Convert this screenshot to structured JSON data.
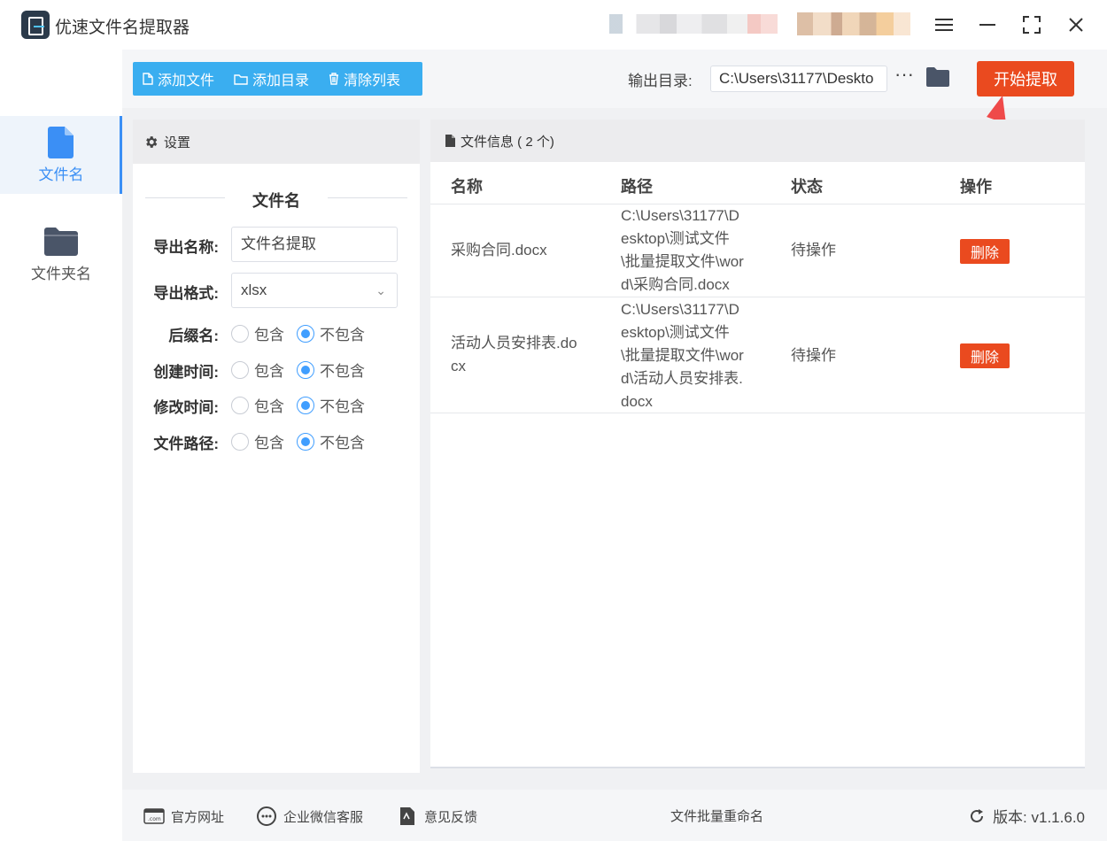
{
  "app": {
    "title": "优速文件名提取器"
  },
  "nav": [
    {
      "label": "文件名",
      "icon": "file-icon",
      "active": true
    },
    {
      "label": "文件夹名",
      "icon": "folder-icon",
      "active": false
    }
  ],
  "toolbar": {
    "add_file": "添加文件",
    "add_dir": "添加目录",
    "clear_list": "清除列表",
    "output_label": "输出目录:",
    "output_value": "C:\\Users\\31177\\Deskto",
    "more": "···",
    "start": "开始提取"
  },
  "settings": {
    "header": "设置",
    "section_title": "文件名",
    "export_name_label": "导出名称:",
    "export_name_value": "文件名提取",
    "export_format_label": "导出格式:",
    "export_format_value": "xlsx",
    "options": [
      {
        "label": "后缀名:",
        "include": "包含",
        "exclude": "不包含",
        "selected": "exclude"
      },
      {
        "label": "创建时间:",
        "include": "包含",
        "exclude": "不包含",
        "selected": "exclude"
      },
      {
        "label": "修改时间:",
        "include": "包含",
        "exclude": "不包含",
        "selected": "exclude"
      },
      {
        "label": "文件路径:",
        "include": "包含",
        "exclude": "不包含",
        "selected": "exclude"
      }
    ]
  },
  "files": {
    "header": "文件信息 ( 2 个)",
    "columns": [
      "名称",
      "路径",
      "状态",
      "操作"
    ],
    "rows": [
      {
        "name": "采购合同.docx",
        "path_lines": [
          "C:\\Users\\31177\\D",
          "esktop\\测试文件",
          "\\批量提取文件\\wor",
          "d\\采购合同.docx"
        ],
        "status": "待操作",
        "action": "删除"
      },
      {
        "name_lines": [
          "活动人员安排表.do",
          "cx"
        ],
        "path_lines": [
          "C:\\Users\\31177\\D",
          "esktop\\测试文件",
          "\\批量提取文件\\wor",
          "d\\活动人员安排表.",
          "docx"
        ],
        "status": "待操作",
        "action": "删除"
      }
    ]
  },
  "footer": {
    "website": "官方网址",
    "wechat": "企业微信客服",
    "feedback": "意见反馈",
    "rename": "文件批量重命名",
    "version": "版本: v1.1.6.0"
  },
  "colors": {
    "accent": "#3aaef0",
    "primary": "#3b8ff5",
    "danger": "#ea4a1f",
    "arrow": "#ef4a4a"
  }
}
